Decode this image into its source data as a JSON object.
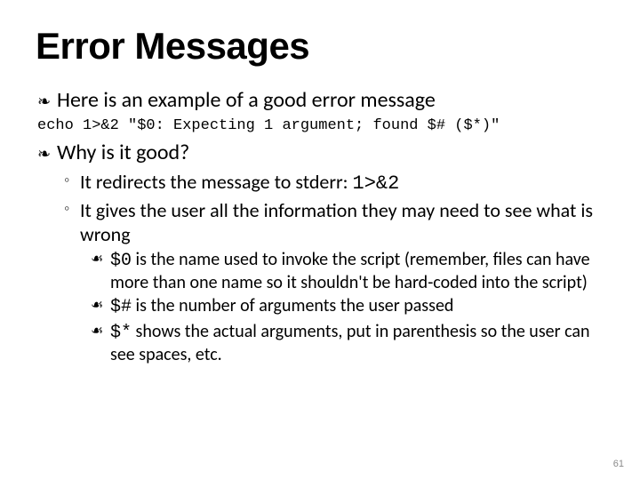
{
  "title": "Error Messages",
  "bullets": {
    "b1": "Here is an example of a good error message",
    "b2": "Why is it good?"
  },
  "code_line": "echo 1>&2 \"$0: Expecting 1 argument; found $# ($*)\"",
  "sub": {
    "s1_pre": "It redirects the message to stderr: ",
    "s1_code": "1>&2",
    "s2": "It gives the user all the information they may need to see what is wrong"
  },
  "subsub": {
    "c1_code": "$0",
    "c1_text": " is the name used to invoke the script (remember, files can have more than one name so it shouldn't be hard-coded into the script)",
    "c2_code": "$#",
    "c2_text": " is the number of arguments the user passed",
    "c3_code": "$*",
    "c3_text": " shows the actual arguments, put in parenthesis so the user can see spaces, etc."
  },
  "glyphs": {
    "bullet1": "❧",
    "bullet2": "◦",
    "bullet3": "☙"
  },
  "page_number": "61"
}
